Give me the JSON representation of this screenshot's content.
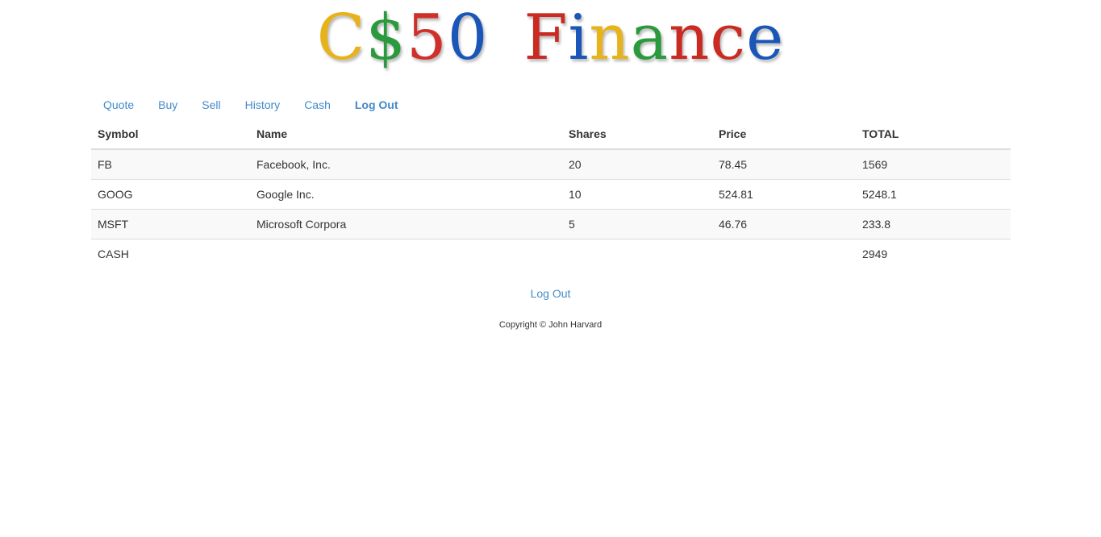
{
  "logo": {
    "text": "C$50 Finance",
    "part1": [
      {
        "ch": "C",
        "color": "#e8b21a"
      },
      {
        "ch": "$",
        "color": "#2a9a3c"
      },
      {
        "ch": "5",
        "color": "#d12f2a"
      },
      {
        "ch": "0",
        "color": "#1a55b8"
      }
    ],
    "part2": [
      {
        "ch": "F",
        "color": "#c92b22"
      },
      {
        "ch": "i",
        "color": "#1a55b8"
      },
      {
        "ch": "n",
        "color": "#e8b21a"
      },
      {
        "ch": "a",
        "color": "#2a9a3c"
      },
      {
        "ch": "n",
        "color": "#c92b22"
      },
      {
        "ch": "c",
        "color": "#c92b22"
      },
      {
        "ch": "e",
        "color": "#1a55b8"
      }
    ]
  },
  "nav": {
    "quote": "Quote",
    "buy": "Buy",
    "sell": "Sell",
    "history": "History",
    "cash": "Cash",
    "logout": "Log Out"
  },
  "table": {
    "headers": {
      "symbol": "Symbol",
      "name": "Name",
      "shares": "Shares",
      "price": "Price",
      "total": "TOTAL"
    },
    "rows": [
      {
        "symbol": "FB",
        "name": "Facebook, Inc.",
        "shares": "20",
        "price": "78.45",
        "total": "1569"
      },
      {
        "symbol": "GOOG",
        "name": "Google Inc.",
        "shares": "10",
        "price": "524.81",
        "total": "5248.1"
      },
      {
        "symbol": "MSFT",
        "name": "Microsoft Corpora",
        "shares": "5",
        "price": "46.76",
        "total": "233.8"
      }
    ],
    "cash": {
      "symbol": "CASH",
      "total": "2949"
    }
  },
  "footer": {
    "logout": "Log Out",
    "copyright": "Copyright © John Harvard"
  },
  "colors": {
    "link": "#428bca",
    "stripe": "#f9f9f9",
    "border": "#dddddd"
  }
}
